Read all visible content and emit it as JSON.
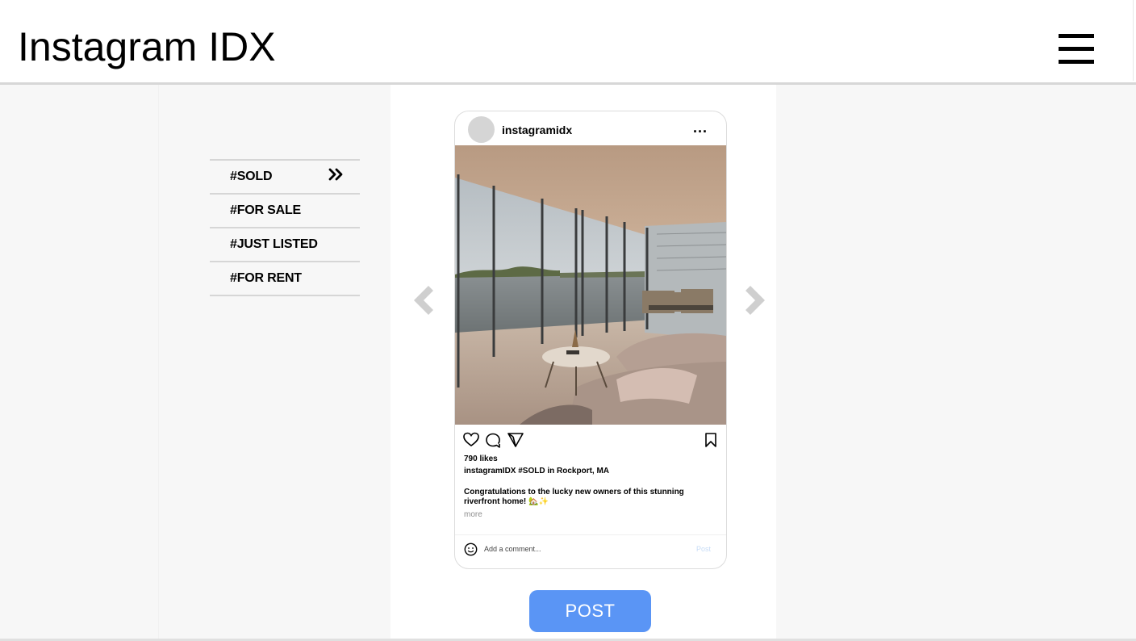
{
  "header": {
    "title": "Instagram IDX",
    "menu_icon": "hamburger-menu-icon"
  },
  "sidebar": {
    "tags": [
      {
        "label": "#SOLD",
        "selected": true,
        "icon": "double-chevron-right-icon"
      },
      {
        "label": "#FOR SALE",
        "selected": false
      },
      {
        "label": "#JUST LISTED",
        "selected": false
      },
      {
        "label": "#FOR RENT",
        "selected": false
      }
    ],
    "selected_chevron": "»"
  },
  "carousel": {
    "prev_icon": "chevron-left-icon",
    "next_icon": "chevron-right-icon"
  },
  "post_card": {
    "username": "instagramidx",
    "more_label": "...",
    "photo": "riverfront-living-room-photo",
    "likes": "790 likes",
    "caption_line": "instagramIDX #SOLD in Rockport, MA",
    "caption_body": "Congratulations to the lucky new owners of this stunning riverfront home! 🏡✨",
    "more_link": "more",
    "comment_placeholder": "Add a comment...",
    "comment_post_label": "Post"
  },
  "post_button": {
    "label": "POST"
  },
  "colors": {
    "accent": "#5a95f5",
    "background": "#f7f7f7",
    "divider": "#d6d6d6",
    "arrow": "#cfcfcf"
  }
}
